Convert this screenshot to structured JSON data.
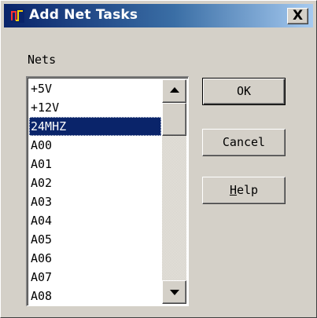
{
  "window": {
    "title": "Add Net Tasks",
    "close_glyph": "X"
  },
  "nets": {
    "label": "Nets",
    "items": [
      "+5V",
      "+12V",
      "24MHZ",
      "A00",
      "A01",
      "A02",
      "A03",
      "A04",
      "A05",
      "A06",
      "A07",
      "A08"
    ],
    "selected": "24MHZ"
  },
  "buttons": {
    "ok_label": "OK",
    "cancel_label": "Cancel",
    "help_mnemonic": "H",
    "help_rest": "elp"
  },
  "icons": {
    "app": "app-logo-icon",
    "close": "close-icon",
    "scroll_up": "scroll-up-arrow-icon",
    "scroll_down": "scroll-down-arrow-icon"
  },
  "colors": {
    "titlebar_start": "#0a246a",
    "titlebar_end": "#a6caf0",
    "selection": "#0a246a",
    "face": "#d4d0c8"
  }
}
